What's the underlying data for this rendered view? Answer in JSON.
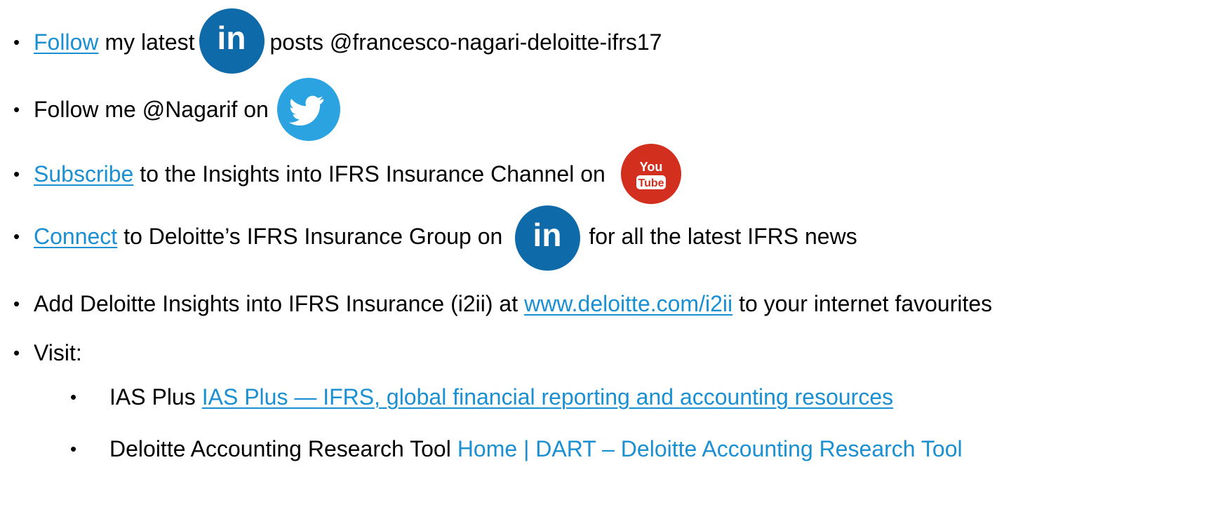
{
  "bullets": {
    "symbol": "•"
  },
  "follow_row": {
    "link": "Follow",
    "text_before_icon": "my latest",
    "icon": "linkedin-icon",
    "text_after_icon": "posts @francesco-nagari-deloitte-ifrs17"
  },
  "twitter_row": {
    "text": "Follow me @Nagarif on",
    "icon": "twitter-icon"
  },
  "subscribe_row": {
    "link": "Subscribe",
    "text": "to the Insights into IFRS Insurance Channel on",
    "icon": "youtube-icon"
  },
  "connect_row": {
    "link": "Connect",
    "text_before_icon": "to Deloitte’s IFRS Insurance Group on",
    "icon": "linkedin-icon",
    "text_after_icon": "for all the latest IFRS news"
  },
  "add_row": {
    "text_before_link": "Add Deloitte Insights into IFRS Insurance (i2ii) at",
    "link": "www.deloitte.com/i2ii",
    "text_after_link": "to your internet favourites"
  },
  "visit_row": {
    "label": "Visit:",
    "items": [
      {
        "label": "IAS Plus",
        "link": "IAS Plus — IFRS, global financial reporting and accounting resources"
      },
      {
        "label": "Deloitte Accounting Research Tool",
        "link": "Home | DART – Deloitte Accounting Research Tool"
      }
    ]
  },
  "colors": {
    "link": "#1a8fd2",
    "linkedin": "#0e6aa8",
    "twitter": "#2aa3e0",
    "youtube": "#d32f1e",
    "text": "#000000"
  }
}
